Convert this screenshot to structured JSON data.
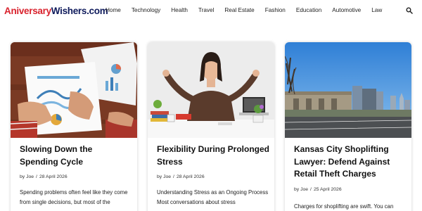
{
  "site": {
    "logo_part1": "Aniversary",
    "logo_part2": "Wishers.com",
    "logo_colors": {
      "part1": "#d9232e",
      "part2": "#0f1b5c"
    }
  },
  "nav": {
    "items": [
      "Home",
      "Technology",
      "Health",
      "Travel",
      "Real Estate",
      "Fashion",
      "Education",
      "Automotive",
      "Law"
    ],
    "search_icon": "search-icon"
  },
  "posts": [
    {
      "title": "Slowing Down the Spending Cycle",
      "by": "by",
      "author": "Joe",
      "separator": "/",
      "date": "28 April 2026",
      "excerpt": "Spending problems often feel like they come from single decisions, but most of the"
    },
    {
      "title": "Flexibility During Prolonged Stress",
      "by": "by",
      "author": "Joe",
      "separator": "/",
      "date": "28 April 2026",
      "excerpt": "Understanding Stress as an Ongoing Process Most conversations about stress"
    },
    {
      "title": "Kansas City Shoplifting Lawyer: Defend Against Retail Theft Charges",
      "by": "by",
      "author": "Joe",
      "separator": "/",
      "date": "25 April 2026",
      "excerpt": "Charges for shoplifting are swift. You can"
    }
  ]
}
